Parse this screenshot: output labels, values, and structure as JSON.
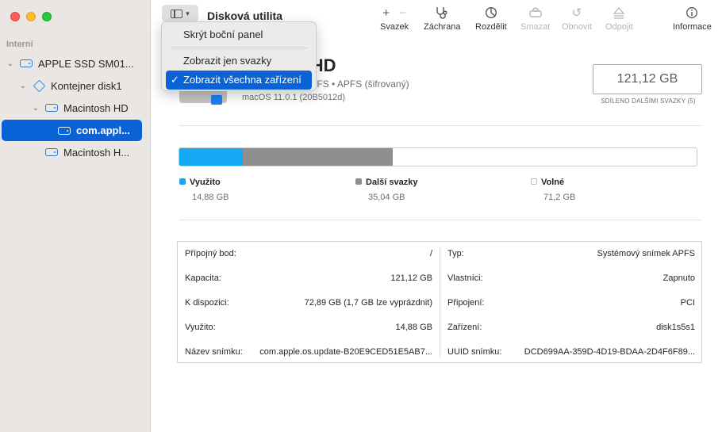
{
  "window": {
    "title": "Disková utilita"
  },
  "sidebar": {
    "section": "Interní",
    "items": [
      {
        "label": "APPLE SSD SM01...",
        "icon": "disk-icon",
        "depth": 0
      },
      {
        "label": "Kontejner disk1",
        "icon": "container-icon",
        "depth": 1
      },
      {
        "label": "Macintosh HD",
        "icon": "disk-icon",
        "depth": 2
      },
      {
        "label": "com.appl...",
        "icon": "disk-icon",
        "depth": 3,
        "selected": true
      },
      {
        "label": "Macintosh H...",
        "icon": "disk-icon",
        "depth": 2
      }
    ]
  },
  "toolbar": {
    "volume": "Svazek",
    "rescue": "Záchrana",
    "partition": "Rozdělit",
    "erase": "Smazat",
    "restore": "Obnovit",
    "unmount": "Odpojit",
    "info": "Informace"
  },
  "menu": {
    "items": [
      {
        "label": "Skrýt boční panel",
        "checked": false
      },
      {
        "label": "Zobrazit jen svazky",
        "checked": false
      },
      {
        "label": "Zobrazit všechna zařízení",
        "checked": true
      }
    ],
    "check": "✓"
  },
  "volume": {
    "name": "sh HD",
    "subtitle": "ek APFS • APFS (šifrovaný)",
    "os": "macOS 11.0.1 (20B5012d)",
    "size": "121,12 GB",
    "shared_caption": "SDÍLENO DALŠÍMI SVAZKY (5)"
  },
  "usage": {
    "used_fraction": 0.1228,
    "other_fraction": 0.2893,
    "colors": {
      "used": "#15a9f5",
      "other": "#8f8f8f",
      "free": "#ffffff"
    },
    "legend": [
      {
        "name": "Využito",
        "value": "14,88 GB"
      },
      {
        "name": "Další svazky",
        "value": "35,04 GB"
      },
      {
        "name": "Volné",
        "value": "71,2 GB"
      }
    ]
  },
  "info": {
    "left": [
      {
        "key": "Přípojný bod:",
        "value": "/"
      },
      {
        "key": "Kapacita:",
        "value": "121,12 GB"
      },
      {
        "key": "K dispozici:",
        "value": "72,89 GB (1,7 GB lze vyprázdnit)"
      },
      {
        "key": "Využito:",
        "value": "14,88 GB"
      },
      {
        "key": "Název snímku:",
        "value": "com.apple.os.update-B20E9CED51E5AB7..."
      }
    ],
    "right": [
      {
        "key": "Typ:",
        "value": "Systémový snímek APFS"
      },
      {
        "key": "Vlastníci:",
        "value": "Zapnuto"
      },
      {
        "key": "Připojení:",
        "value": "PCI"
      },
      {
        "key": "Zařízení:",
        "value": "disk1s5s1"
      },
      {
        "key": "UUID snímku:",
        "value": "DCD699AA-359D-4D19-BDAA-2D4F6F89..."
      }
    ]
  }
}
